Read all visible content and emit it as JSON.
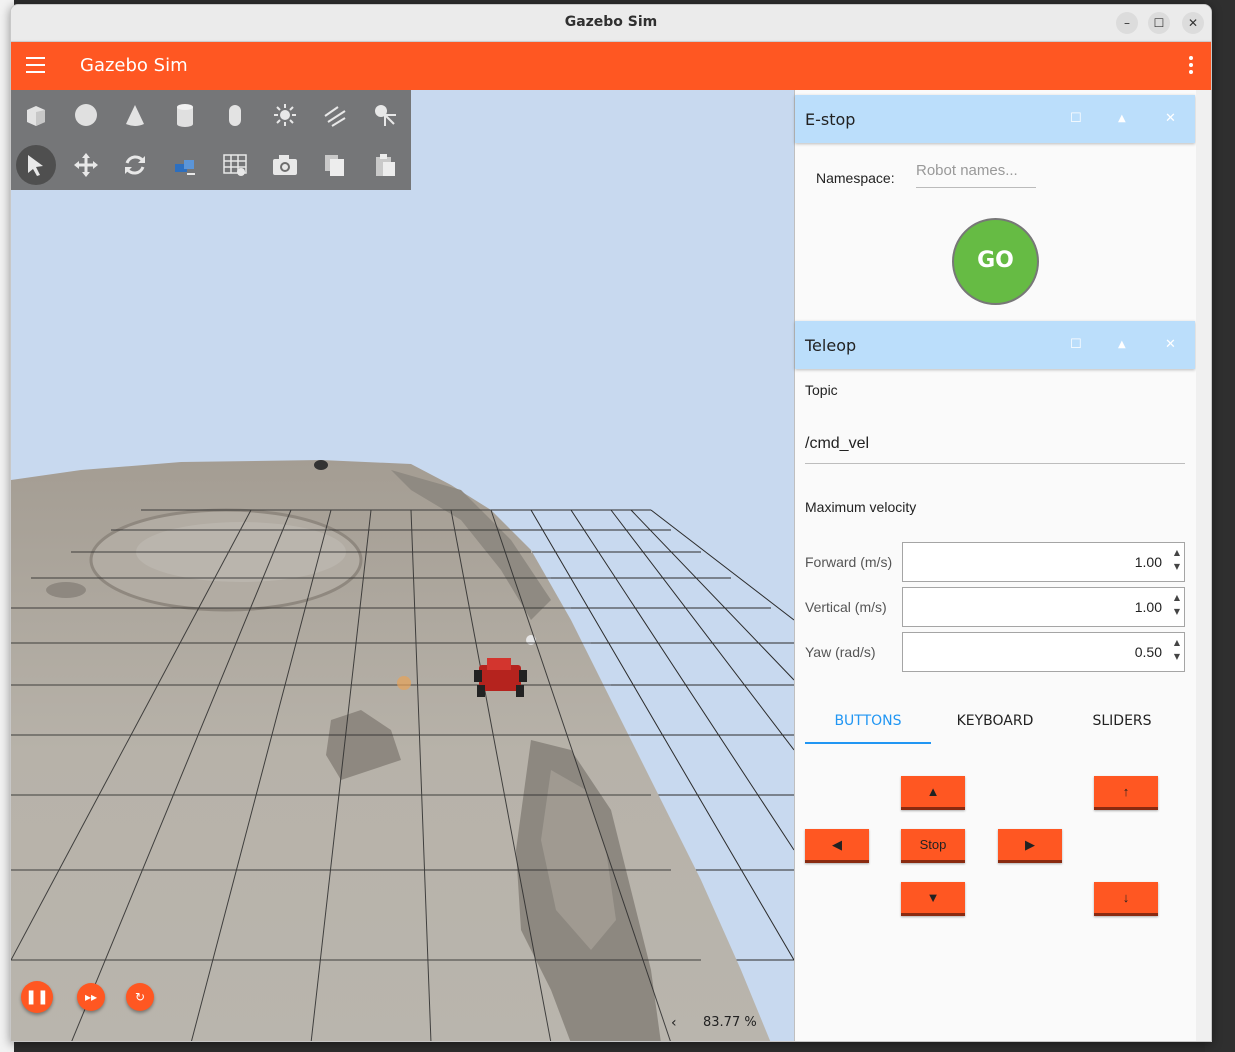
{
  "window": {
    "title": "Gazebo Sim"
  },
  "appbar": {
    "title": "Gazebo Sim"
  },
  "toolbar": {
    "shapes": [
      "box-icon",
      "sphere-icon",
      "cone-icon",
      "cylinder-icon",
      "capsule-icon",
      "sun-light-icon",
      "directional-light-icon",
      "spot-light-icon"
    ],
    "tools": [
      "select-arrow-icon",
      "translate-icon",
      "rotate-icon",
      "transform-tool-icon",
      "grid-config-icon",
      "screenshot-camera-icon",
      "copy-icon",
      "paste-icon"
    ]
  },
  "scene": {
    "zoom": "83.77 %"
  },
  "estop": {
    "title": "E-stop",
    "namespace_label": "Namespace:",
    "namespace_placeholder": "Robot names...",
    "go_label": "GO"
  },
  "teleop": {
    "title": "Teleop",
    "topic_label": "Topic",
    "topic_value": "/cmd_vel",
    "max_velocity_label": "Maximum velocity",
    "forward_label": "Forward (m/s)",
    "forward_value": "1.00",
    "vertical_label": "Vertical (m/s)",
    "vertical_value": "1.00",
    "yaw_label": "Yaw (rad/s)",
    "yaw_value": "0.50",
    "tabs": [
      "BUTTONS",
      "KEYBOARD",
      "SLIDERS"
    ],
    "buttons": {
      "forward": "▲",
      "backward": "▼",
      "left": "◀",
      "right": "▶",
      "stop": "Stop",
      "up": "↑",
      "down": "↓"
    }
  },
  "colors": {
    "accent": "#ff5722",
    "panel_header": "#bbdefb",
    "go_button": "#66bb44",
    "tab_active": "#2196f3",
    "sky": "#c8d9ef"
  }
}
